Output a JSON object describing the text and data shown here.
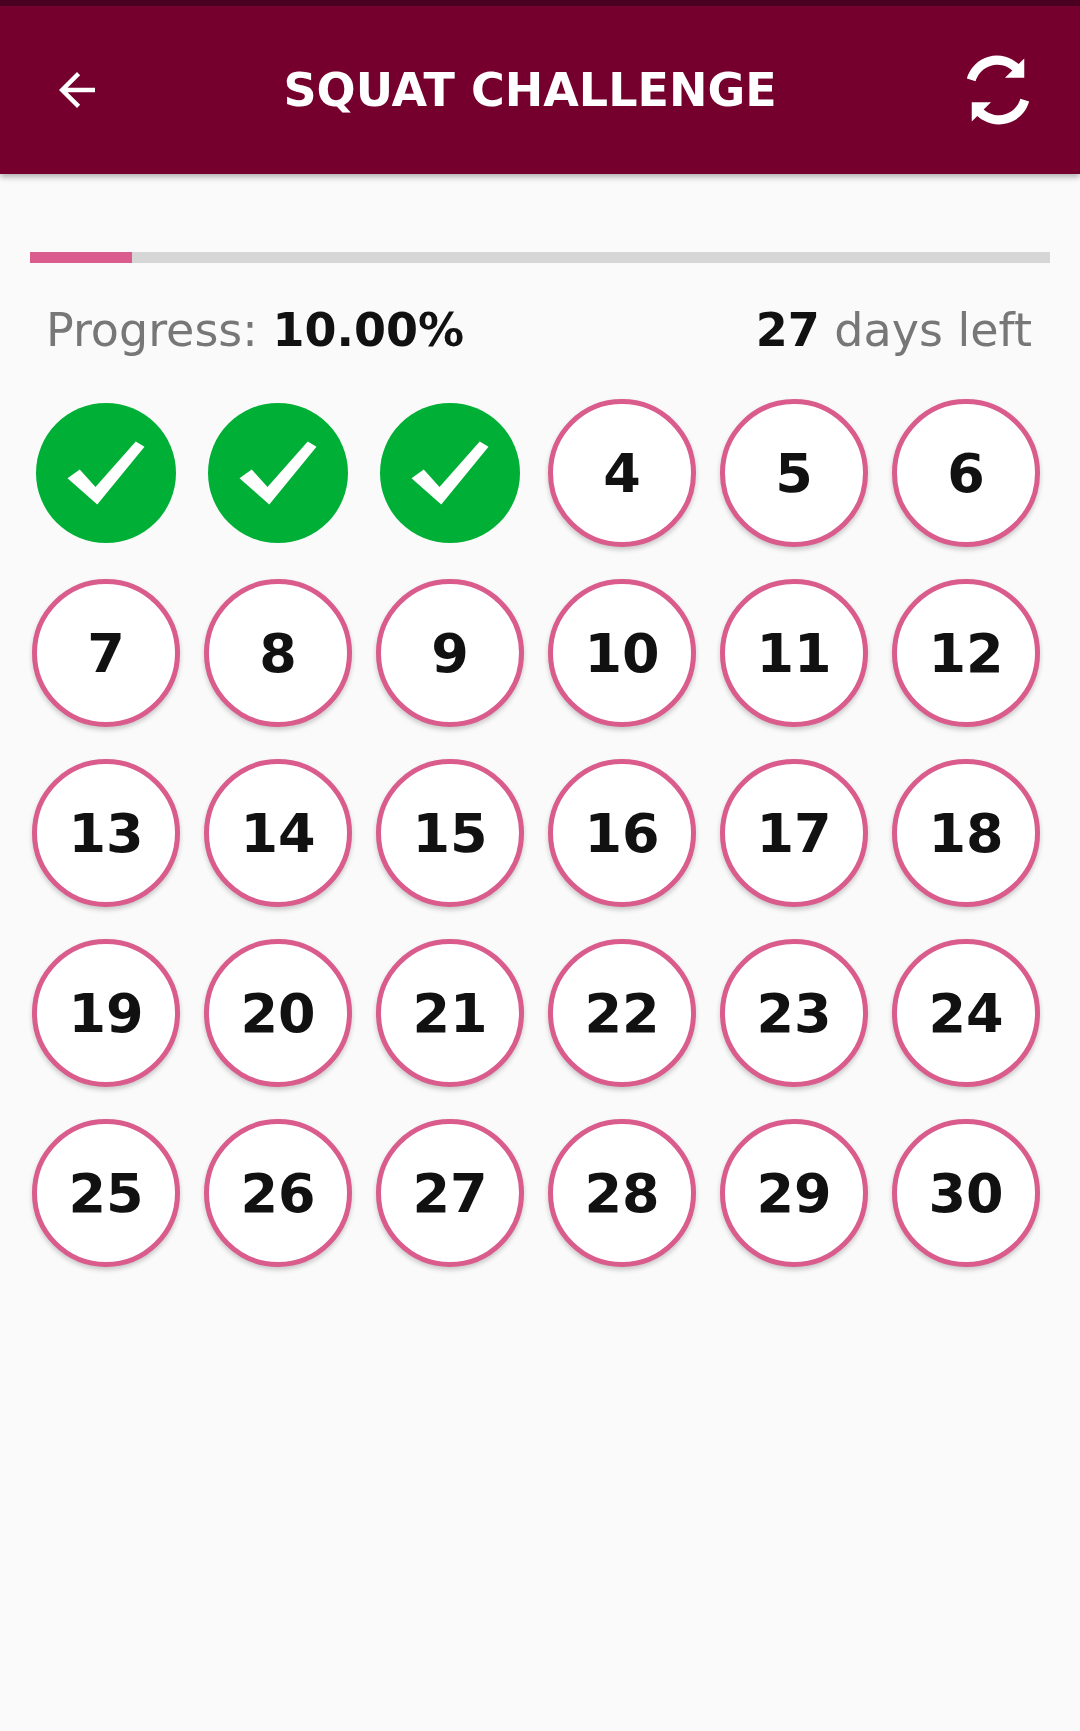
{
  "app_bar": {
    "title": "SQUAT CHALLENGE"
  },
  "progress": {
    "level": 0.1,
    "label": "Progress: **10.00%**",
    "days_left": "**27** days left"
  },
  "days": [
    {
      "done": true
    },
    {
      "done": true
    },
    {
      "done": true
    },
    {
      "label": "4",
      "done": false
    },
    {
      "label": "5",
      "done": false
    },
    {
      "label": "6",
      "done": false
    },
    {
      "label": "7",
      "done": false
    },
    {
      "label": "8",
      "done": false
    },
    {
      "label": "9",
      "done": false
    },
    {
      "label": "10",
      "done": false
    },
    {
      "label": "11",
      "done": false
    },
    {
      "label": "12",
      "done": false
    },
    {
      "label": "13",
      "done": false
    },
    {
      "label": "14",
      "done": false
    },
    {
      "label": "15",
      "done": false
    },
    {
      "label": "16",
      "done": false
    },
    {
      "label": "17",
      "done": false
    },
    {
      "label": "18",
      "done": false
    },
    {
      "label": "19",
      "done": false
    },
    {
      "label": "20",
      "done": false
    },
    {
      "label": "21",
      "done": false
    },
    {
      "label": "22",
      "done": false
    },
    {
      "label": "23",
      "done": false
    },
    {
      "label": "24",
      "done": false
    },
    {
      "label": "25",
      "done": false
    },
    {
      "label": "26",
      "done": false
    },
    {
      "label": "27",
      "done": false
    },
    {
      "label": "28",
      "done": false
    },
    {
      "label": "29",
      "done": false
    },
    {
      "label": "30",
      "done": false
    }
  ]
}
